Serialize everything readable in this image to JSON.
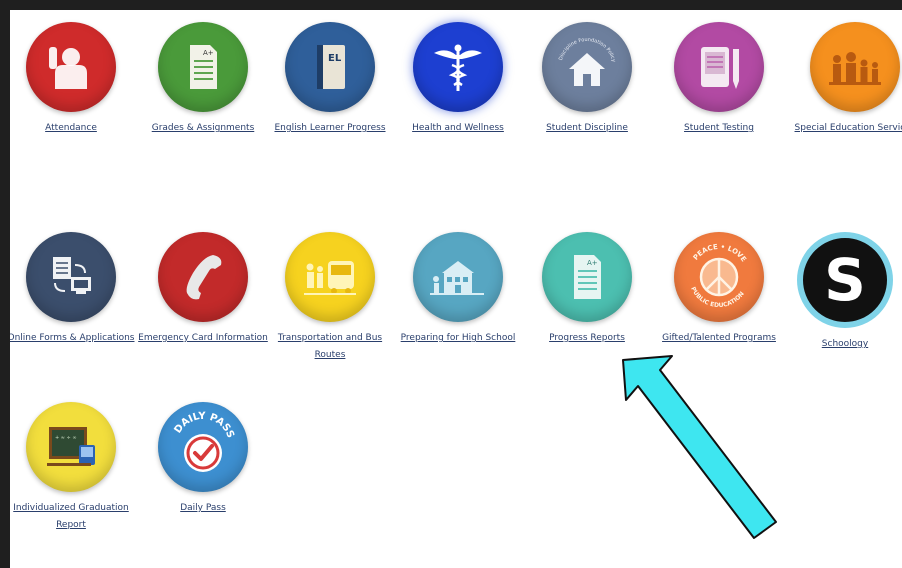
{
  "tiles": [
    {
      "label": "Attendance",
      "icon": "attendance-icon",
      "color": "#cf2b2b"
    },
    {
      "label": "Grades & Assignments",
      "icon": "grades-icon",
      "color": "#4a9a3a"
    },
    {
      "label": "English Learner Progress",
      "icon": "english-learner-icon",
      "color": "#2f5f9a",
      "badge": "EL"
    },
    {
      "label": "Health and Wellness",
      "icon": "caduceus-icon",
      "color": "#1d3fd1"
    },
    {
      "label": "Student Discipline",
      "icon": "house-icon",
      "color": "#6d7f9d",
      "ring_text": "Discipline Foundation Policy"
    },
    {
      "label": "Student Testing",
      "icon": "testing-icon",
      "color": "#b24aa3"
    },
    {
      "label": "Special Education Services",
      "icon": "family-icon",
      "color": "#f5901e"
    },
    {
      "label": "Online Forms & Applications",
      "icon": "online-forms-icon",
      "color": "#3b4e6c"
    },
    {
      "label": "Emergency Card Information",
      "icon": "phone-icon",
      "color": "#c22a2a"
    },
    {
      "label": "Transportation and Bus Routes",
      "icon": "bus-icon",
      "color": "#f6d21f"
    },
    {
      "label": "Preparing for High School",
      "icon": "school-icon",
      "color": "#57a6c2"
    },
    {
      "label": "Progress Reports",
      "icon": "progress-report-icon",
      "color": "#4cbfb0",
      "badge": "A+"
    },
    {
      "label": "Gifted/Talented Programs",
      "icon": "peace-icon",
      "color": "#f07a3e",
      "ring_top": "PEACE • LOVE",
      "ring_bottom": "PUBLIC EDUCATION"
    },
    {
      "label": "Schoology",
      "icon": "schoology-icon",
      "color": "#111111",
      "ring": "#7fd3e8",
      "letter": "S"
    },
    {
      "label": "Individualized Graduation Report",
      "icon": "chalkboard-icon",
      "color": "#f2de3d",
      "board_text": "+ ≈ ÷ ∞"
    },
    {
      "label": "Daily Pass",
      "icon": "daily-pass-icon",
      "color": "#3d8fd0",
      "ring_text": "DAILY PASS"
    }
  ],
  "arrow": {
    "color": "#3ee6f0",
    "name": "pointer-arrow"
  }
}
